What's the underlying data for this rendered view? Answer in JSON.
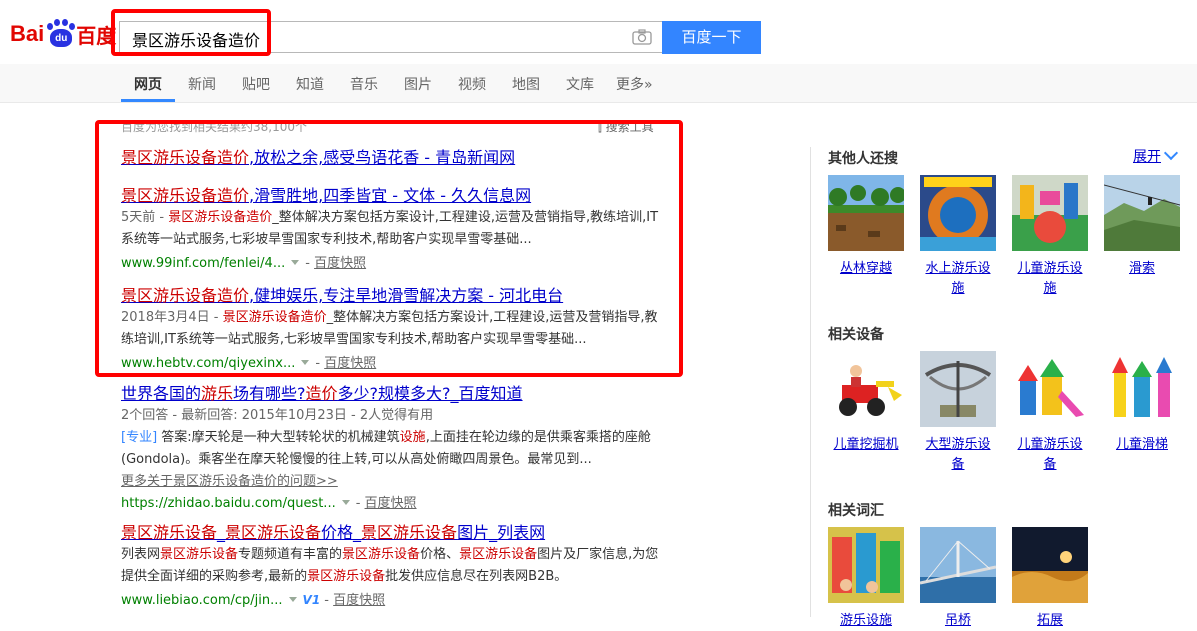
{
  "header": {
    "logo": {
      "part1": "Bai",
      "paw_text": "du",
      "part2": "百度"
    },
    "search_value": "景区游乐设备造价",
    "search_button": "百度一下"
  },
  "tabs": [
    "网页",
    "新闻",
    "贴吧",
    "知道",
    "音乐",
    "图片",
    "视频",
    "地图",
    "文库",
    "更多»"
  ],
  "results_meta": {
    "count_text": "百度为您找到相关结果约38,100个",
    "tools": "搜索工具"
  },
  "results": [
    {
      "title_kw": "景区游乐设备造价",
      "title_rest": ",放松之余,感受鸟语花香 - 青岛新闻网"
    },
    {
      "title_kw": "景区游乐设备造价",
      "title_rest": ",滑雪胜地,四季皆宜 - 文体 - 久久信息网",
      "date": "5天前 - ",
      "abs_kw": "景区游乐设备造价",
      "abs_1": "_整体解决方案包括方案设计,工程建设,运营及营销指导,教练培训,IT",
      "abs_2": "系统等一站式服务,七彩坡旱雪国家专利技术,帮助客户实现旱雪零基础...",
      "url": "www.99inf.com/fenlei/4...",
      "snap": "百度快照"
    },
    {
      "title_kw": "景区游乐设备造价",
      "title_rest": ",健坤娱乐,专注旱地滑雪解决方案 - 河北电台",
      "date": "2018年3月4日 - ",
      "abs_kw": "景区游乐设备造价",
      "abs_1": "_整体解决方案包括方案设计,工程建设,运营及营销指导,教",
      "abs_2": "练培训,IT系统等一站式服务,七彩坡旱雪国家专利技术,帮助客户实现旱雪零基础...",
      "url": "www.hebtv.com/qiyexinx...",
      "snap": "百度快照"
    },
    {
      "title_a": "世界各国的",
      "title_kw1": "游乐",
      "title_b": "场有哪些?",
      "title_kw2": "造价",
      "title_c": "多少?规模多大?_百度知道",
      "meta": "2个回答 - 最新回答: 2015年10月23日 - 2人觉得有用",
      "tag": "[专业]",
      "abs_1a": " 答案:摩天轮是一种大型转轮状的机械建筑",
      "abs_kw": "设施",
      "abs_1b": ",上面挂在轮边缘的是供乘客乘搭的座舱",
      "abs_2": "(Gondola)。乘客坐在摩天轮慢慢的往上转,可以从高处俯瞰四周景色。最常见到...",
      "more": "更多关于景区游乐设备造价的问题>>",
      "url": "https://zhidao.baidu.com/quest...",
      "snap": "百度快照"
    },
    {
      "title_kw1": "景区游乐设备",
      "title_a": "_",
      "title_kw2": "景区游乐设备",
      "title_b": "价格_",
      "title_kw3": "景区游乐设备",
      "title_c": "图片_列表网",
      "abs_1a": "列表网",
      "abs_kw1": "景区游乐设备",
      "abs_1b": "专题频道有丰富的",
      "abs_kw2": "景区游乐设备",
      "abs_1c": "价格、",
      "abs_kw3": "景区游乐设备",
      "abs_1d": "图片及厂家信息,为您",
      "abs_2a": "提供全面详细的采购参考,最新的",
      "abs_kw4": "景区游乐设备",
      "abs_2b": "批发供应信息尽在列表网B2B。",
      "url": "www.liebiao.com/cp/jin...",
      "v1": "V1",
      "snap": "百度快照"
    }
  ],
  "right": {
    "others_title": "其他人还搜",
    "expand": "展开",
    "others": [
      "丛林穿越",
      "水上游乐设施",
      "儿童游乐设施",
      "滑索"
    ],
    "equip_title": "相关设备",
    "equip": [
      "儿童挖掘机",
      "大型游乐设备",
      "儿童游乐设备",
      "儿童滑梯"
    ],
    "words_title": "相关词汇",
    "words": [
      "游乐设施",
      "吊桥",
      "拓展"
    ]
  },
  "colors": {
    "accent": "#3385ff",
    "highlight": "#cc0000",
    "link": "#0000cc",
    "url": "#008000",
    "annotation": "#ff0000"
  }
}
